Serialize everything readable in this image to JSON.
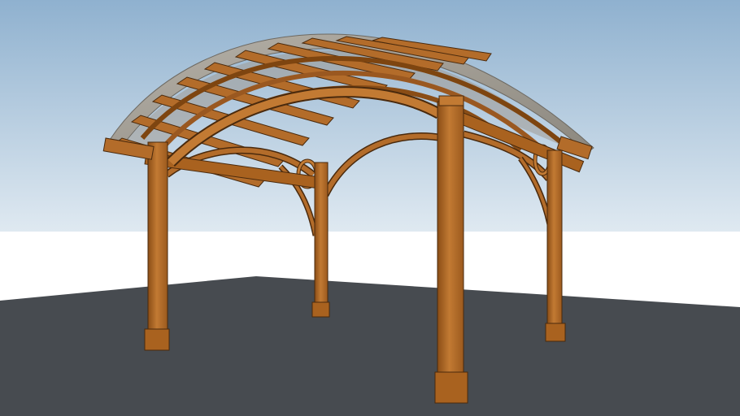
{
  "scene": {
    "subject": "pergola-3d-model",
    "elements": {
      "sky": "sky",
      "horizon": "horizon-band",
      "ground": "ground-plane",
      "posts": [
        "post-back-left",
        "post-back-middle",
        "post-back-right",
        "post-front-right"
      ],
      "beams": [
        "arched-beam-left",
        "arched-beam-front",
        "arched-beam-right"
      ],
      "roof": "curved-roof-slats"
    }
  },
  "colors": {
    "sky_top": "#8fb1cf",
    "sky_bottom": "#dfe9f1",
    "horizon": "#ffffff",
    "ground": "#474b50",
    "wood": "#b36c2a",
    "wood_light": "#cf8a42",
    "wood_dark": "#7e4510",
    "wood_edge": "#4a2a0d",
    "roof_gray": "#9a968f"
  }
}
